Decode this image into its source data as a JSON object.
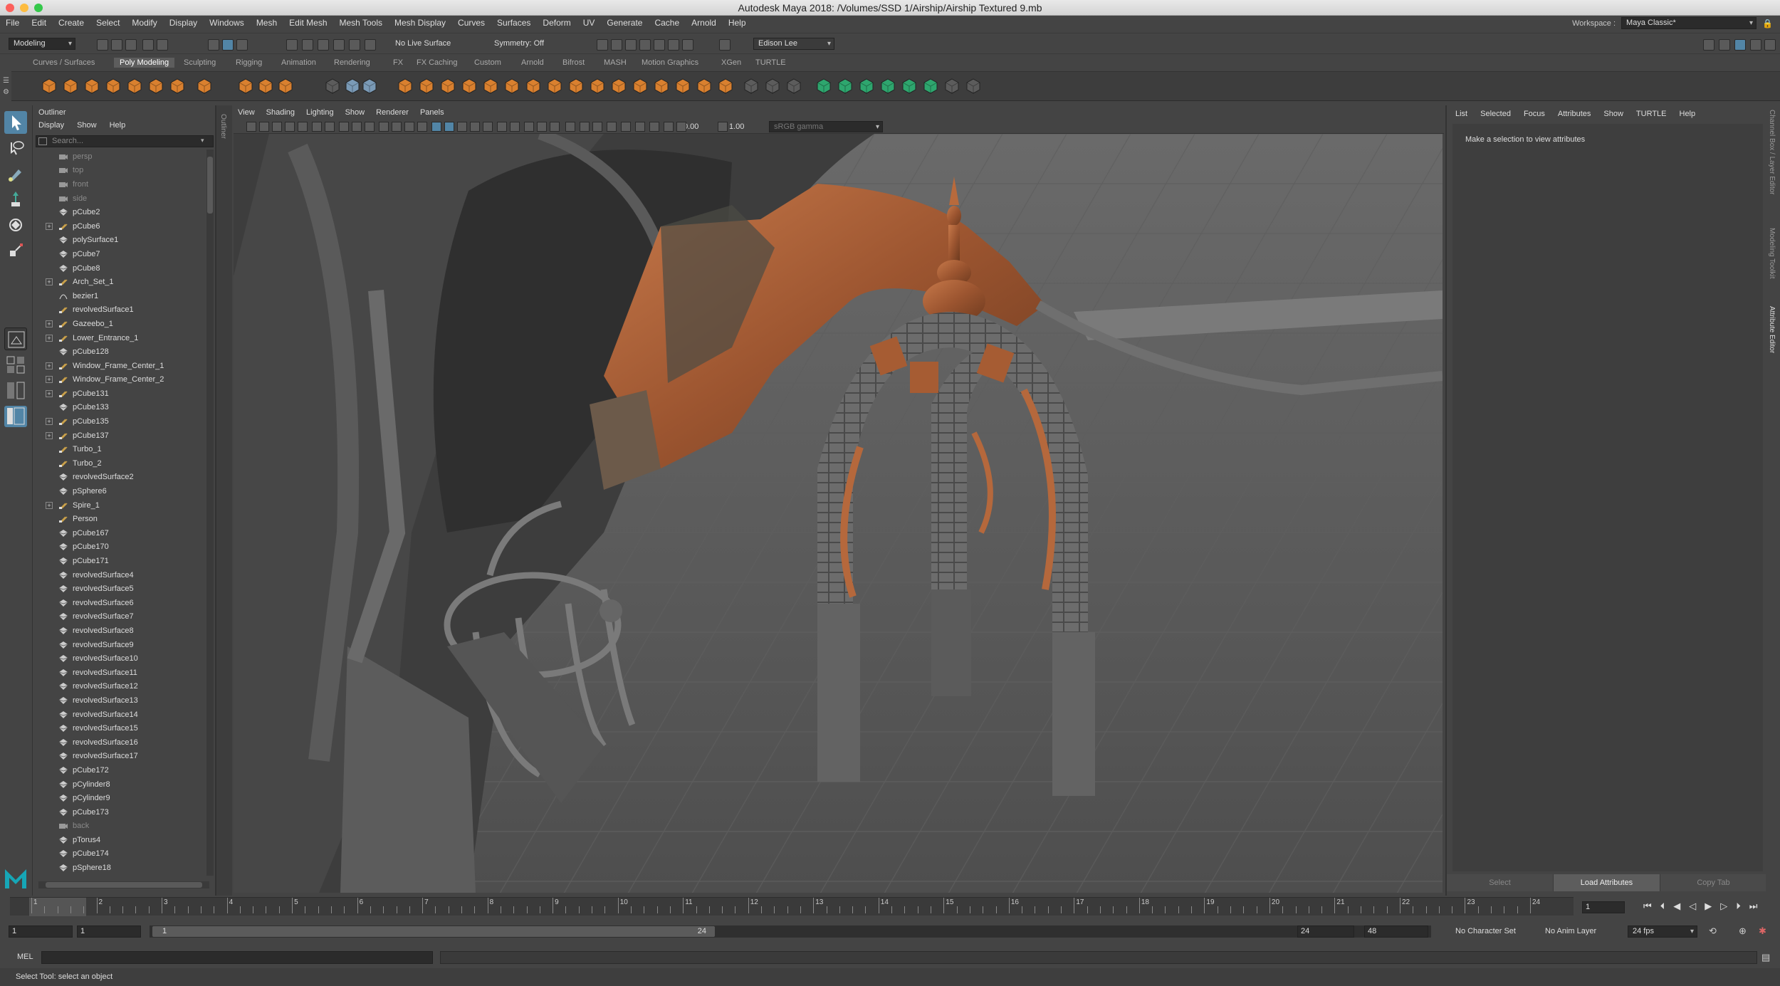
{
  "window": {
    "title": "Autodesk Maya 2018: /Volumes/SSD 1/Airship/Airship Textured 9.mb"
  },
  "menubar": [
    "File",
    "Edit",
    "Create",
    "Select",
    "Modify",
    "Display",
    "Windows",
    "Mesh",
    "Edit Mesh",
    "Mesh Tools",
    "Mesh Display",
    "Curves",
    "Surfaces",
    "Deform",
    "UV",
    "Generate",
    "Cache",
    "Arnold",
    "Help"
  ],
  "workspace": {
    "label": "Workspace :",
    "value": "Maya Classic*"
  },
  "statusline": {
    "mode": "Modeling",
    "live_surface": "No Live Surface",
    "symmetry": "Symmetry: Off",
    "user": "Edison Lee"
  },
  "shelf_tabs": [
    "Curves / Surfaces",
    "Poly Modeling",
    "Sculpting",
    "Rigging",
    "Animation",
    "Rendering",
    "FX",
    "FX Caching",
    "Custom",
    "Arnold",
    "Bifrost",
    "MASH",
    "Motion Graphics",
    "XGen",
    "TURTLE"
  ],
  "shelf_active_tab": "Poly Modeling",
  "outliner": {
    "title": "Outliner",
    "menu": [
      "Display",
      "Show",
      "Help"
    ],
    "search_placeholder": "Search...",
    "items": [
      {
        "label": "persp",
        "type": "camera",
        "expand": false
      },
      {
        "label": "top",
        "type": "camera",
        "expand": false
      },
      {
        "label": "front",
        "type": "camera",
        "expand": false
      },
      {
        "label": "side",
        "type": "camera",
        "expand": false
      },
      {
        "label": "pCube2",
        "type": "mesh",
        "expand": false
      },
      {
        "label": "pCube6",
        "type": "group",
        "expand": true
      },
      {
        "label": "polySurface1",
        "type": "mesh",
        "expand": false
      },
      {
        "label": "pCube7",
        "type": "mesh",
        "expand": false
      },
      {
        "label": "pCube8",
        "type": "mesh",
        "expand": false
      },
      {
        "label": "Arch_Set_1",
        "type": "group",
        "expand": true
      },
      {
        "label": "bezier1",
        "type": "curve",
        "expand": false
      },
      {
        "label": "revolvedSurface1",
        "type": "group",
        "expand": false
      },
      {
        "label": "Gazeebo_1",
        "type": "group",
        "expand": true
      },
      {
        "label": "Lower_Entrance_1",
        "type": "group",
        "expand": true
      },
      {
        "label": "pCube128",
        "type": "mesh",
        "expand": false
      },
      {
        "label": "Window_Frame_Center_1",
        "type": "group",
        "expand": true
      },
      {
        "label": "Window_Frame_Center_2",
        "type": "group",
        "expand": true
      },
      {
        "label": "pCube131",
        "type": "group",
        "expand": true
      },
      {
        "label": "pCube133",
        "type": "mesh",
        "expand": false
      },
      {
        "label": "pCube135",
        "type": "group",
        "expand": true
      },
      {
        "label": "pCube137",
        "type": "group",
        "expand": true
      },
      {
        "label": "Turbo_1",
        "type": "group",
        "expand": false
      },
      {
        "label": "Turbo_2",
        "type": "group",
        "expand": false
      },
      {
        "label": "revolvedSurface2",
        "type": "mesh",
        "expand": false
      },
      {
        "label": "pSphere6",
        "type": "mesh",
        "expand": false
      },
      {
        "label": "Spire_1",
        "type": "group",
        "expand": true
      },
      {
        "label": "Person",
        "type": "group",
        "expand": false
      },
      {
        "label": "pCube167",
        "type": "mesh",
        "expand": false
      },
      {
        "label": "pCube170",
        "type": "mesh",
        "expand": false
      },
      {
        "label": "pCube171",
        "type": "mesh",
        "expand": false
      },
      {
        "label": "revolvedSurface4",
        "type": "mesh",
        "expand": false
      },
      {
        "label": "revolvedSurface5",
        "type": "mesh",
        "expand": false
      },
      {
        "label": "revolvedSurface6",
        "type": "mesh",
        "expand": false
      },
      {
        "label": "revolvedSurface7",
        "type": "mesh",
        "expand": false
      },
      {
        "label": "revolvedSurface8",
        "type": "mesh",
        "expand": false
      },
      {
        "label": "revolvedSurface9",
        "type": "mesh",
        "expand": false
      },
      {
        "label": "revolvedSurface10",
        "type": "mesh",
        "expand": false
      },
      {
        "label": "revolvedSurface11",
        "type": "mesh",
        "expand": false
      },
      {
        "label": "revolvedSurface12",
        "type": "mesh",
        "expand": false
      },
      {
        "label": "revolvedSurface13",
        "type": "mesh",
        "expand": false
      },
      {
        "label": "revolvedSurface14",
        "type": "mesh",
        "expand": false
      },
      {
        "label": "revolvedSurface15",
        "type": "mesh",
        "expand": false
      },
      {
        "label": "revolvedSurface16",
        "type": "mesh",
        "expand": false
      },
      {
        "label": "revolvedSurface17",
        "type": "mesh",
        "expand": false
      },
      {
        "label": "pCube172",
        "type": "mesh",
        "expand": false
      },
      {
        "label": "pCylinder8",
        "type": "mesh",
        "expand": false
      },
      {
        "label": "pCylinder9",
        "type": "mesh",
        "expand": false
      },
      {
        "label": "pCube173",
        "type": "mesh",
        "expand": false
      },
      {
        "label": "back",
        "type": "camera",
        "expand": false
      },
      {
        "label": "pTorus4",
        "type": "mesh",
        "expand": false
      },
      {
        "label": "pCube174",
        "type": "mesh",
        "expand": false
      },
      {
        "label": "pSphere18",
        "type": "mesh",
        "expand": false
      }
    ]
  },
  "viewport": {
    "menu": [
      "View",
      "Shading",
      "Lighting",
      "Show",
      "Renderer",
      "Panels"
    ],
    "exposure": "0.00",
    "gamma": "1.00",
    "colorspace": "sRGB gamma"
  },
  "attribute_editor": {
    "tabs": [
      "List",
      "Selected",
      "Focus",
      "Attributes",
      "Show",
      "TURTLE",
      "Help"
    ],
    "message": "Make a selection to view attributes",
    "buttons": [
      "Select",
      "Load Attributes",
      "Copy Tab"
    ],
    "side_labels": [
      "Channel Box / Layer Editor",
      "Modeling Toolkit",
      "Attribute Editor"
    ],
    "left_side_label": "Outliner"
  },
  "timeslider": {
    "ticks": [
      "1",
      "2",
      "3",
      "4",
      "5",
      "6",
      "7",
      "8",
      "9",
      "10",
      "11",
      "12",
      "13",
      "14",
      "15",
      "16",
      "17",
      "18",
      "19",
      "20",
      "21",
      "22",
      "23",
      "24"
    ],
    "current": "1"
  },
  "range": {
    "start": "1",
    "start2": "1",
    "handle_start": "1",
    "handle_end": "24",
    "end": "24",
    "end2": "48",
    "character_set": "No Character Set",
    "anim_layer": "No Anim Layer",
    "fps": "24 fps"
  },
  "command": {
    "label": "MEL"
  },
  "help_line": "Select Tool: select an object",
  "colors": {
    "accent": "#5285a6",
    "copper": "#b5683c",
    "panel": "#444444"
  }
}
